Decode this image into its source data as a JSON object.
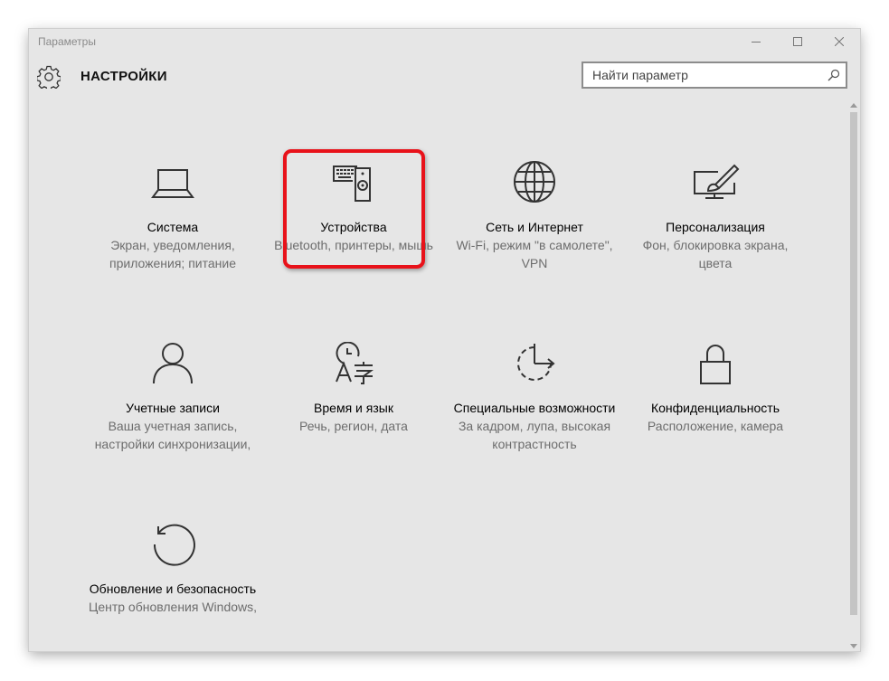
{
  "window": {
    "title": "Параметры"
  },
  "header": {
    "title": "НАСТРОЙКИ",
    "search_placeholder": "Найти параметр"
  },
  "tiles": [
    {
      "icon": "laptop-icon",
      "title": "Система",
      "description": "Экран, уведомления, приложения; питание"
    },
    {
      "icon": "devices-icon",
      "title": "Устройства",
      "description": "Bluetooth, принтеры, мышь",
      "highlighted": true
    },
    {
      "icon": "globe-icon",
      "title": "Сеть и Интернет",
      "description": "Wi-Fi, режим \"в самолете\", VPN"
    },
    {
      "icon": "personalization-icon",
      "title": "Персонализация",
      "description": "Фон, блокировка экрана, цвета"
    },
    {
      "icon": "person-icon",
      "title": "Учетные записи",
      "description": "Ваша учетная запись, настройки синхронизации,"
    },
    {
      "icon": "time-language-icon",
      "title": "Время и язык",
      "description": "Речь, регион, дата"
    },
    {
      "icon": "ease-of-access-icon",
      "title": "Специальные возможности",
      "description": "За кадром, лупа, высокая контрастность"
    },
    {
      "icon": "lock-icon",
      "title": "Конфиденциальность",
      "description": "Расположение, камера"
    },
    {
      "icon": "update-icon",
      "title": "Обновление и безопасность",
      "description": "Центр обновления Windows,"
    }
  ],
  "colors": {
    "window_bg": "#e6e6e6",
    "highlight": "#e8121a",
    "title_text": "#000000",
    "desc_text": "#6d6d6d"
  }
}
